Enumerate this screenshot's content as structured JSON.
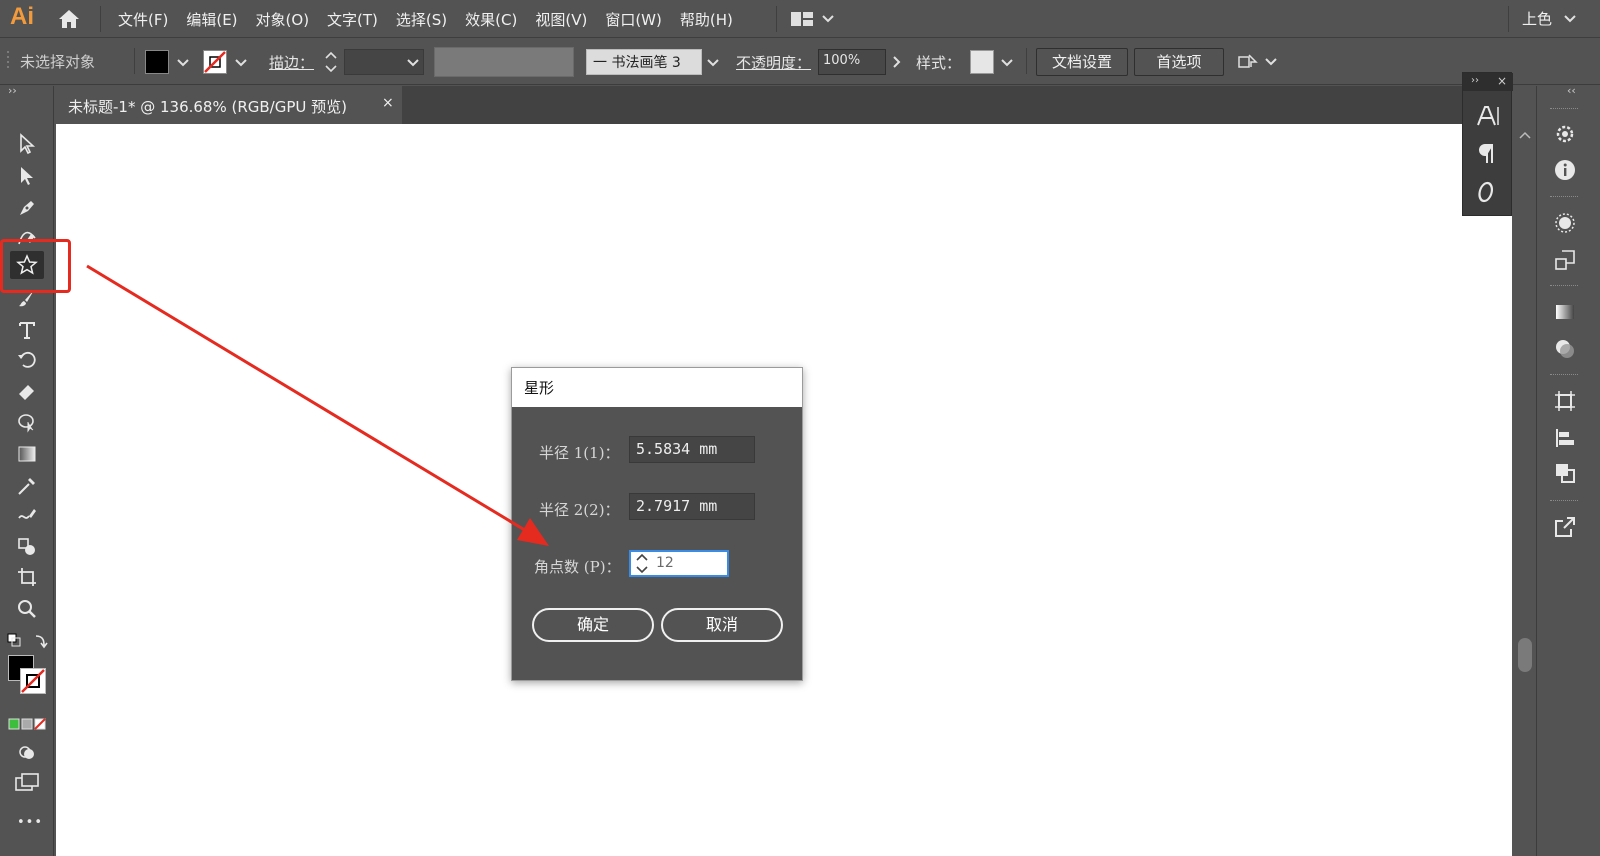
{
  "app": {
    "logo": "Ai",
    "workspace": "上色"
  },
  "menu": [
    "文件(F)",
    "编辑(E)",
    "对象(O)",
    "文字(T)",
    "选择(S)",
    "效果(C)",
    "视图(V)",
    "窗口(W)",
    "帮助(H)"
  ],
  "control_bar": {
    "selection_status": "未选择对象",
    "stroke_label": "描边：",
    "brush_name": "一 书法画笔 3",
    "opacity_label": "不透明度：",
    "opacity_value": "100%",
    "style_label": "样式：",
    "doc_setup_button": "文档设置",
    "preferences_button": "首选项"
  },
  "document_tab": {
    "title": "未标题-1* @ 136.68% (RGB/GPU 预览)",
    "close": "×"
  },
  "colors": {
    "ui_bg": "#535353",
    "canvas": "#ffffff",
    "accent_orange": "#f39a3c",
    "annotation_red": "#e52a20",
    "focus_blue": "#3a8be6"
  },
  "dialog": {
    "title": "星形",
    "radius1_label": "半径 1(1)：",
    "radius1_value": "5.5834 mm",
    "radius2_label": "半径 2(2)：",
    "radius2_value": "2.7917 mm",
    "points_label": "角点数 (P)：",
    "points_value": "12",
    "ok_button": "确定",
    "cancel_button": "取消"
  },
  "mini_panel": {
    "collapse": "››",
    "close": "×"
  },
  "right_dock": {
    "collapse": "‹‹"
  },
  "toolbar": {
    "collapse": "››",
    "more": "•••"
  }
}
